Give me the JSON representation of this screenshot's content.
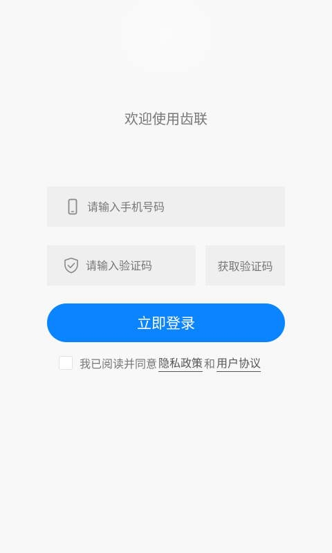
{
  "welcome_text": "欢迎使用齿联",
  "phone": {
    "icon": "phone-icon",
    "placeholder": "请输入手机号码",
    "value": ""
  },
  "code": {
    "icon": "shield-check-icon",
    "placeholder": "请输入验证码",
    "value": ""
  },
  "get_code_label": "获取验证码",
  "login_label": "立即登录",
  "agreement": {
    "checked": false,
    "prefix": "我已阅读并同意",
    "privacy_link": "隐私政策",
    "conjunction": "和",
    "terms_link": "用户协议"
  },
  "colors": {
    "accent": "#0a84ff",
    "field_bg": "#efefef",
    "page_bg": "#f8f8f8"
  }
}
